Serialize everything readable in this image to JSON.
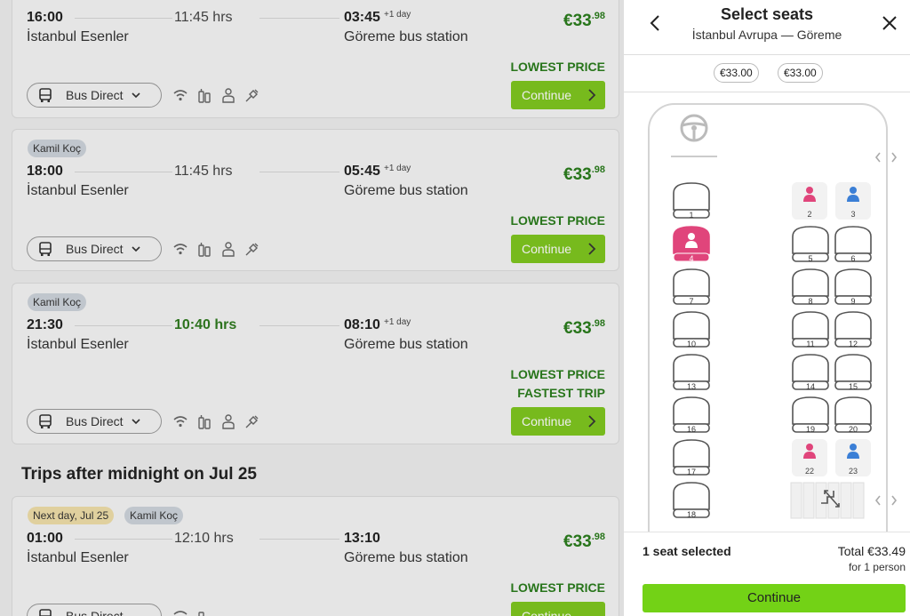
{
  "trips": [
    {
      "operator": "",
      "dep_time": "16:00",
      "dep_station": "İstanbul Esenler",
      "duration": "11:45 hrs",
      "arr_time": "03:45",
      "arr_day": "+1 day",
      "arr_station": "Göreme bus station",
      "price_main": "€33",
      "price_cents": ".98",
      "labels": [
        "LOWEST PRICE"
      ],
      "bus_type": "Bus Direct",
      "cta": "Continue"
    },
    {
      "operator": "Kamil Koç",
      "dep_time": "18:00",
      "dep_station": "İstanbul Esenler",
      "duration": "11:45 hrs",
      "arr_time": "05:45",
      "arr_day": "+1 day",
      "arr_station": "Göreme bus station",
      "price_main": "€33",
      "price_cents": ".98",
      "labels": [
        "LOWEST PRICE"
      ],
      "bus_type": "Bus Direct",
      "cta": "Continue"
    },
    {
      "operator": "Kamil Koç",
      "dep_time": "21:30",
      "dep_station": "İstanbul Esenler",
      "duration": "10:40 hrs",
      "arr_time": "08:10",
      "arr_day": "+1 day",
      "arr_station": "Göreme bus station",
      "price_main": "€33",
      "price_cents": ".98",
      "labels": [
        "LOWEST PRICE",
        "FASTEST TRIP"
      ],
      "bus_type": "Bus Direct",
      "cta": "Continue"
    },
    {
      "operator": "Kamil Koç",
      "next_day": "Next day, Jul 25",
      "dep_time": "01:00",
      "dep_station": "İstanbul Esenler",
      "duration": "12:10 hrs",
      "arr_time": "13:10",
      "arr_day": "",
      "arr_station": "Göreme bus station",
      "price_main": "€33",
      "price_cents": ".98",
      "labels": [
        "LOWEST PRICE"
      ],
      "bus_type": "Bus Direct",
      "cta": "Continue"
    }
  ],
  "section_title": "Trips after midnight on Jul 25",
  "panel": {
    "title": "Select seats",
    "route": "İstanbul Avrupa — Göreme",
    "price_chips": [
      "€33.00",
      "€33.00"
    ],
    "selected_count": "1 seat selected",
    "total": "Total €33.49",
    "per_person": "for 1 person",
    "cta": "Continue"
  },
  "seats": {
    "available": [
      "1",
      "5",
      "6",
      "7",
      "8",
      "9",
      "10",
      "11",
      "12",
      "13",
      "14",
      "15",
      "16",
      "17",
      "18",
      "19",
      "20"
    ],
    "selected": [
      "4"
    ],
    "occupied_female": [
      "2",
      "22"
    ],
    "occupied_male": [
      "3",
      "23"
    ]
  },
  "colors": {
    "accent": "#73c209",
    "price": "#2b7d1d",
    "selected_seat": "#e0457b",
    "male_seat": "#3b7fd6"
  }
}
